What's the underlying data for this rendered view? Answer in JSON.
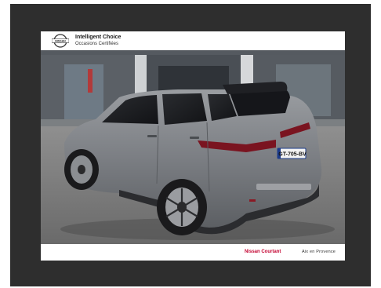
{
  "header": {
    "logo_icon": "nissan-logo-icon",
    "logo_text": "NISSAN",
    "title": "Intelligent Choice",
    "subtitle": "Occasions Certifiées"
  },
  "photo": {
    "license_plate": "GT-705-BV"
  },
  "footer": {
    "dealer": "Nissan Courtant",
    "city": "Aix en Provence"
  },
  "colors": {
    "frame": "#2e2e2e",
    "car_body": "#7b7e83",
    "brand_red": "#c3002f"
  }
}
